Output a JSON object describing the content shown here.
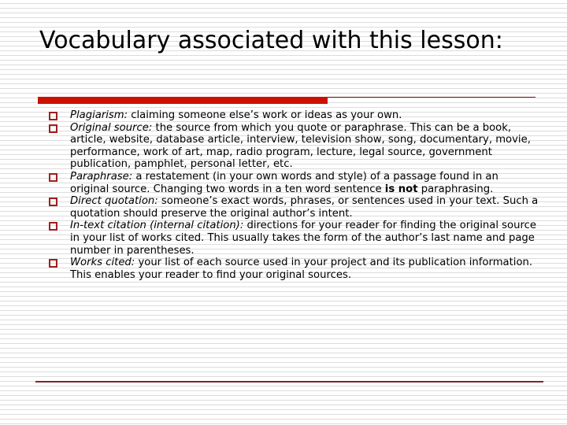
{
  "slide": {
    "title": "Vocabulary associated with this lesson:",
    "accent_color": "#cc1100",
    "rule_color": "#7b1414",
    "footer_rule_color": "#7b2430",
    "bullet_color": "#9e1f1f",
    "bullet_icon": "hollow-square-bullet"
  },
  "vocabulary": [
    {
      "term": "Plagiarism:",
      "definition": " claiming someone else’s work or ideas as your own.",
      "definition_tail": ""
    },
    {
      "term": "Original source:",
      "definition": " the source from which you quote or paraphrase.  This can be a book, article, website, database article, interview, television show, song, documentary, movie, performance, work of art, map, radio program, lecture, legal source, government publication, pamphlet, personal letter, etc.",
      "definition_tail": ""
    },
    {
      "term": "Paraphrase:",
      "definition": " a restatement (in your own words and style) of a passage found in an original source.  Changing two words in a ten word sentence ",
      "emphasis": "is not",
      "definition_tail": " paraphrasing."
    },
    {
      "term": "Direct quotation:",
      "definition": " someone’s exact words, phrases, or sentences used in your text.  Such a quotation should preserve the original author’s intent.",
      "definition_tail": ""
    },
    {
      "term": "In-text citation (internal citation):",
      "definition": " directions for your reader for finding the original source in your list of works cited.  This usually takes the form of the author’s last name and page number in parentheses.",
      "definition_tail": ""
    },
    {
      "term": "Works cited:",
      "definition": " your list of each source used in your project and its publication information.  This enables your reader to find your original sources.",
      "definition_tail": ""
    }
  ]
}
